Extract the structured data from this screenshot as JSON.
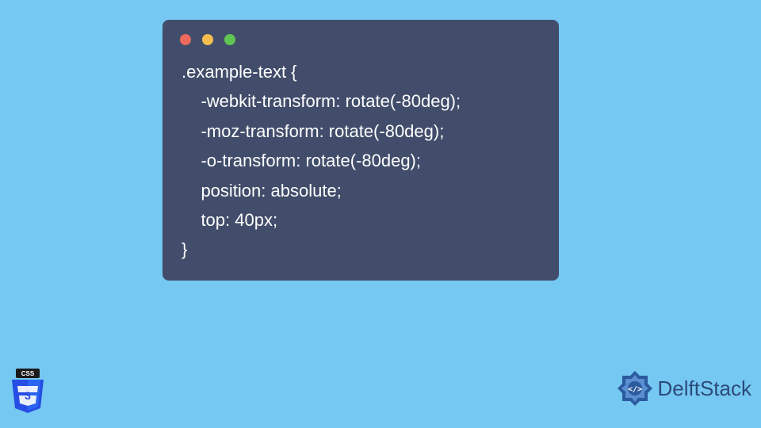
{
  "code": {
    "line1": ".example-text {",
    "line2": "    -webkit-transform: rotate(-80deg);",
    "line3": "    -moz-transform: rotate(-80deg);",
    "line4": "    -o-transform: rotate(-80deg);",
    "line5": "    position: absolute;",
    "line6": "    top: 40px;",
    "line7": "}"
  },
  "brand": {
    "name": "DelftStack",
    "css_label": "CSS"
  },
  "colors": {
    "close": "#ec6a5e",
    "minimize": "#f4be4f",
    "zoom": "#61c554"
  }
}
